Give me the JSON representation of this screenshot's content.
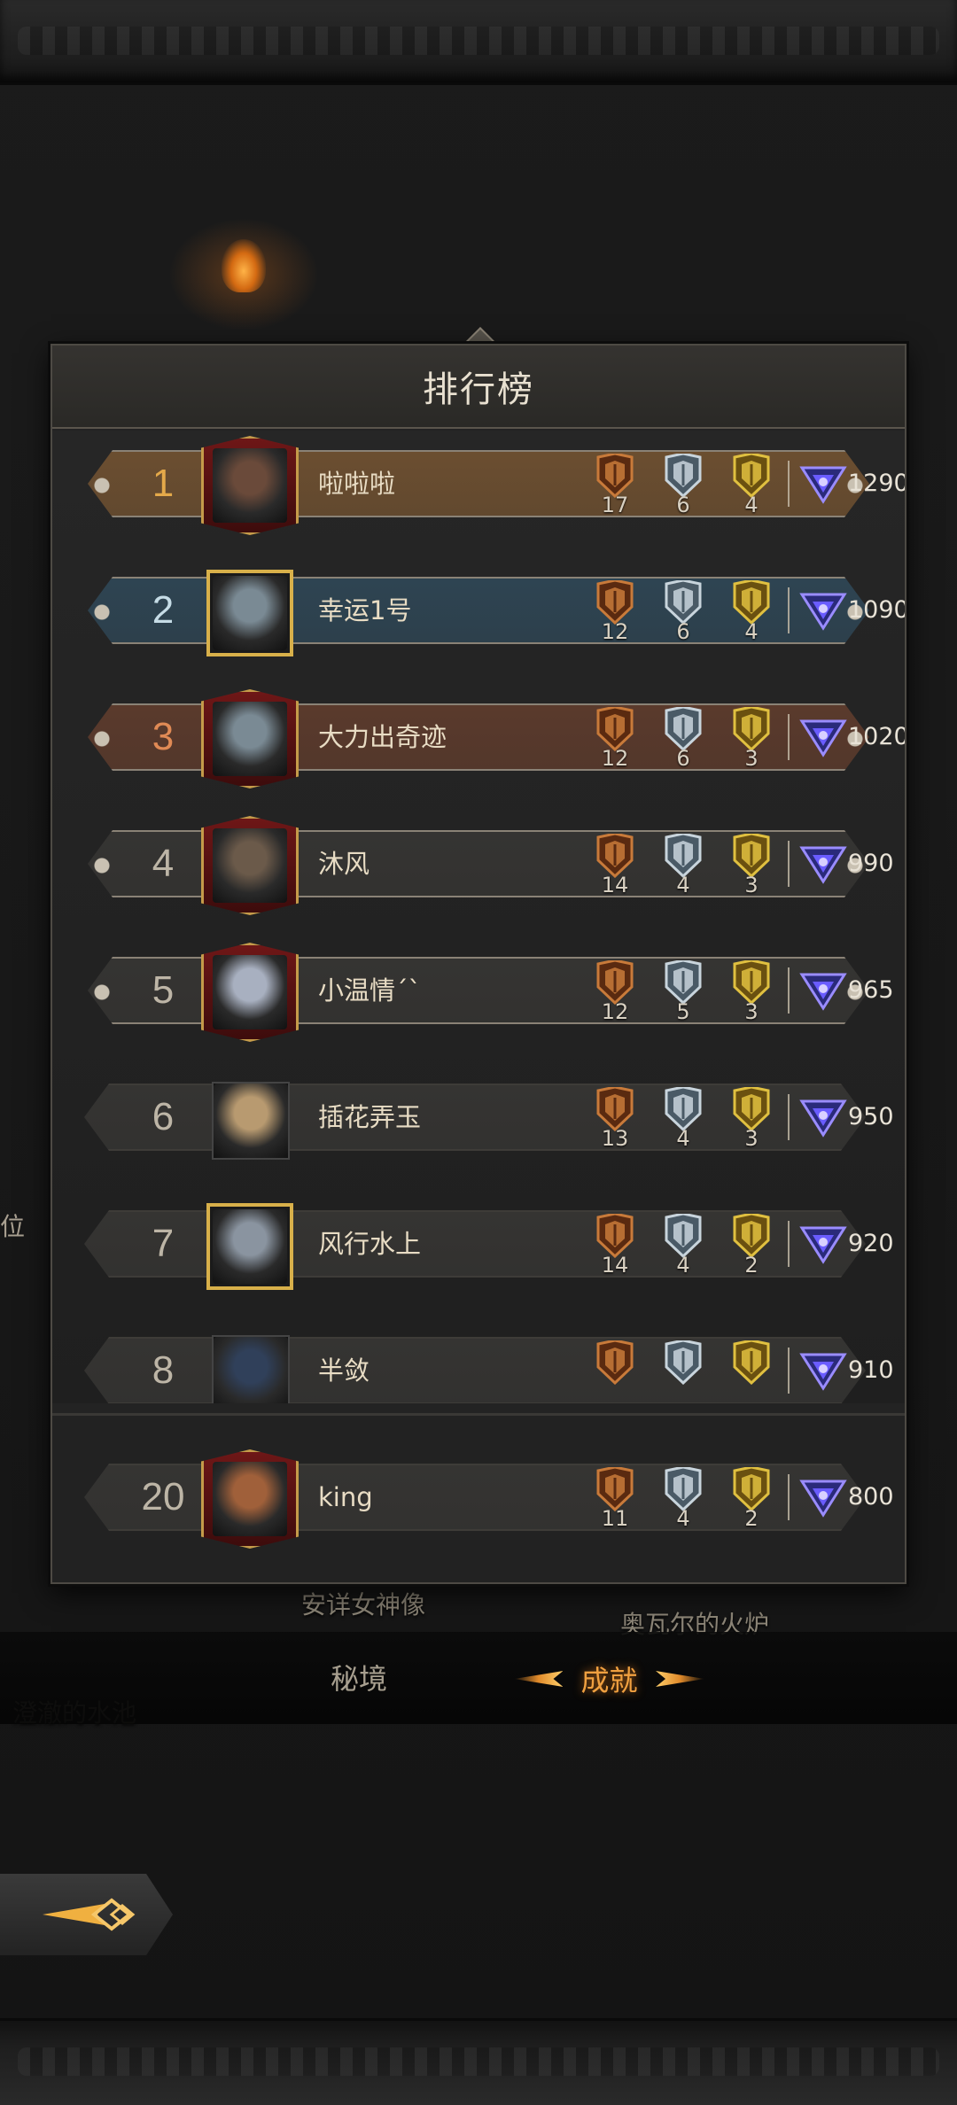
{
  "panel": {
    "title": "排行榜"
  },
  "background": {
    "labels": [
      "安详女神像",
      "奥瓦尔的火炉",
      "澄澈的水池"
    ],
    "side_stub": "位"
  },
  "tabs": [
    {
      "label": "秘境",
      "active": false
    },
    {
      "label": "成就",
      "active": true
    }
  ],
  "colors": {
    "rank1_bar": "#6b4e30",
    "rank2_bar": "#2e4452",
    "rank3_bar": "#5a3a2c",
    "default_bar": "#353432",
    "rank1_text": "#e4a94a",
    "rank2_text": "#c6dce6",
    "rank3_text": "#e08a55",
    "rank_text": "#bdb5a6",
    "accent": "#f0a040"
  },
  "rows": [
    {
      "rank": "1",
      "name": "啦啦啦",
      "bronze": "17",
      "silver": "6",
      "gold": "4",
      "score": "1290"
    },
    {
      "rank": "2",
      "name": "幸运1号",
      "bronze": "12",
      "silver": "6",
      "gold": "4",
      "score": "1090"
    },
    {
      "rank": "3",
      "name": "大力出奇迹",
      "bronze": "12",
      "silver": "6",
      "gold": "3",
      "score": "1020"
    },
    {
      "rank": "4",
      "name": "沐风",
      "bronze": "14",
      "silver": "4",
      "gold": "3",
      "score": "990"
    },
    {
      "rank": "5",
      "name": "小温情ˊˋ",
      "bronze": "12",
      "silver": "5",
      "gold": "3",
      "score": "965"
    },
    {
      "rank": "6",
      "name": "插花弄玉",
      "bronze": "13",
      "silver": "4",
      "gold": "3",
      "score": "950"
    },
    {
      "rank": "7",
      "name": "风行水上",
      "bronze": "14",
      "silver": "4",
      "gold": "2",
      "score": "920"
    },
    {
      "rank": "8",
      "name": "半敛",
      "bronze": "",
      "silver": "",
      "gold": "",
      "score": "910"
    }
  ],
  "self_row": {
    "rank": "20",
    "name": "king",
    "bronze": "11",
    "silver": "4",
    "gold": "2",
    "score": "800"
  },
  "icons": {
    "back": "back-arrow-icon",
    "bronze": "bronze-medal-icon",
    "silver": "silver-medal-icon",
    "gold": "gold-medal-icon",
    "score": "score-crystal-icon"
  }
}
